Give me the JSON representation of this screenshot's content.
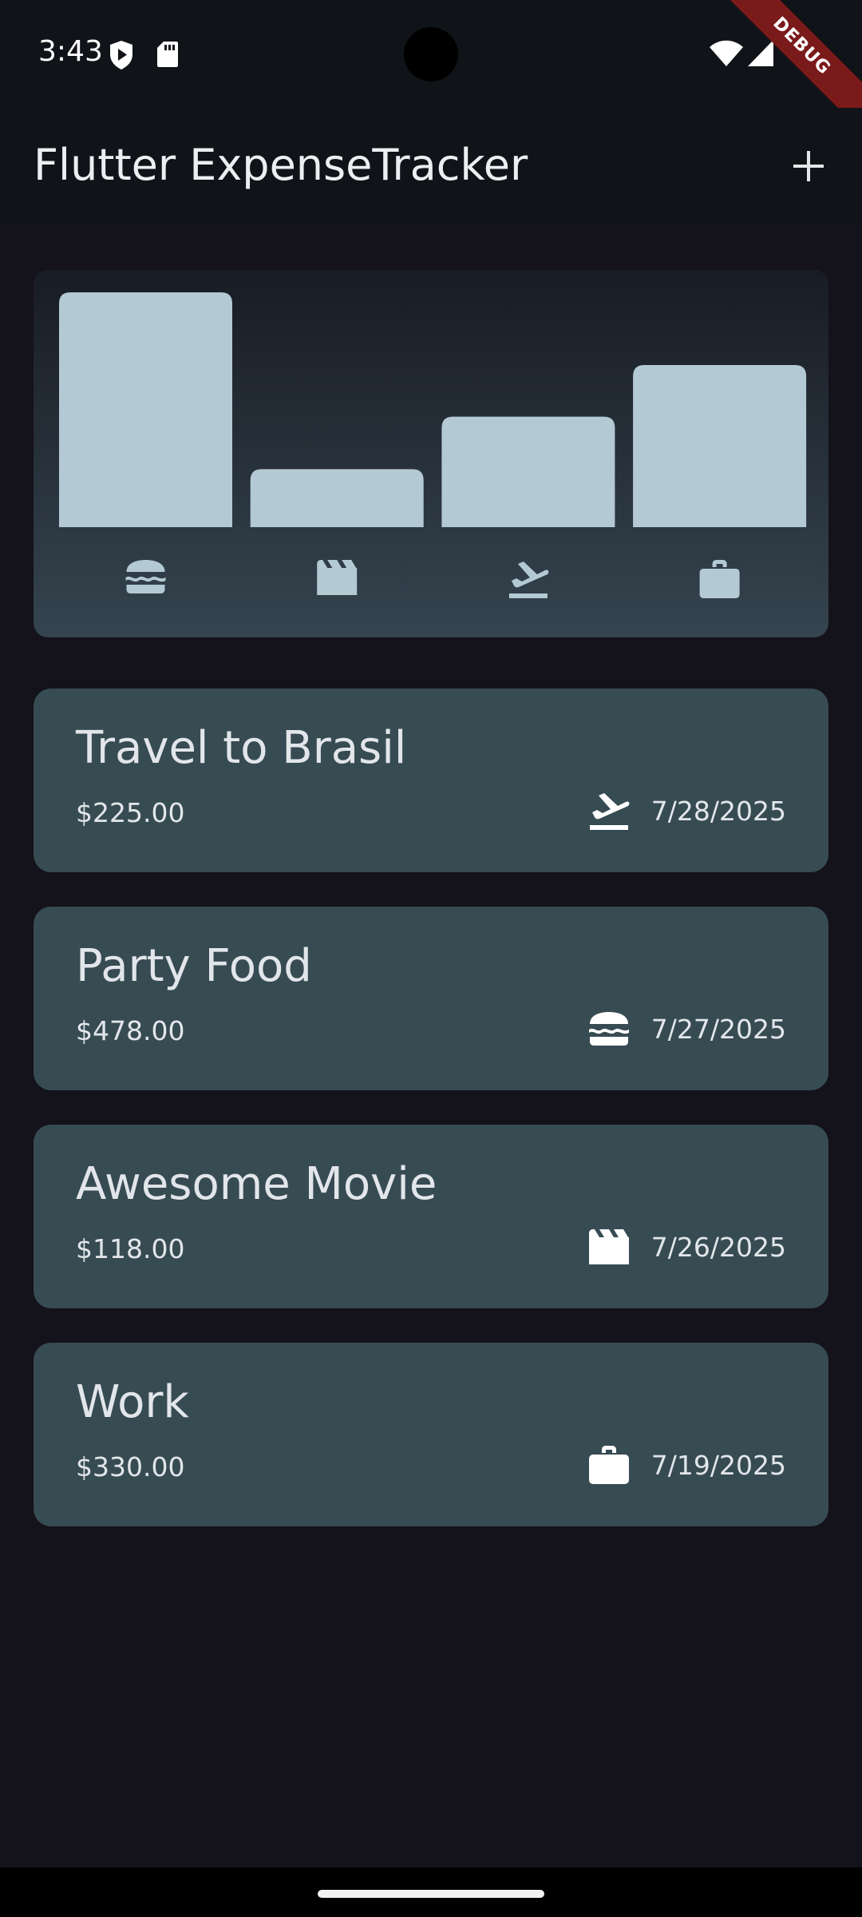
{
  "status_bar": {
    "time": "3:43",
    "left_icons": [
      "shield-play-icon",
      "sd-card-icon"
    ],
    "right_icons": [
      "wifi-icon",
      "cellular-signal-icon"
    ],
    "debug_banner": "DEBUG"
  },
  "app_bar": {
    "title": "Flutter ExpenseTracker",
    "add_icon": "plus-icon"
  },
  "colors": {
    "background": "#14121a",
    "card": "#374b53",
    "bar": "#b3c9d3",
    "debug_banner": "#7b1a1a"
  },
  "chart_data": {
    "type": "bar",
    "categories": [
      "food",
      "leisure",
      "travel",
      "work"
    ],
    "category_icons": [
      "hamburger-icon",
      "movie-clapper-icon",
      "flight-takeoff-icon",
      "briefcase-icon"
    ],
    "values": [
      478,
      118,
      225,
      330
    ],
    "title": "",
    "xlabel": "",
    "ylabel": "",
    "ylim": [
      0,
      478
    ]
  },
  "expenses": [
    {
      "title": "Travel to Brasil",
      "amount": "$225.00",
      "icon": "flight-takeoff-icon",
      "date": "7/28/2025"
    },
    {
      "title": "Party Food",
      "amount": "$478.00",
      "icon": "hamburger-icon",
      "date": "7/27/2025"
    },
    {
      "title": "Awesome Movie",
      "amount": "$118.00",
      "icon": "movie-clapper-icon",
      "date": "7/26/2025"
    },
    {
      "title": "Work",
      "amount": "$330.00",
      "icon": "briefcase-icon",
      "date": "7/19/2025"
    }
  ]
}
